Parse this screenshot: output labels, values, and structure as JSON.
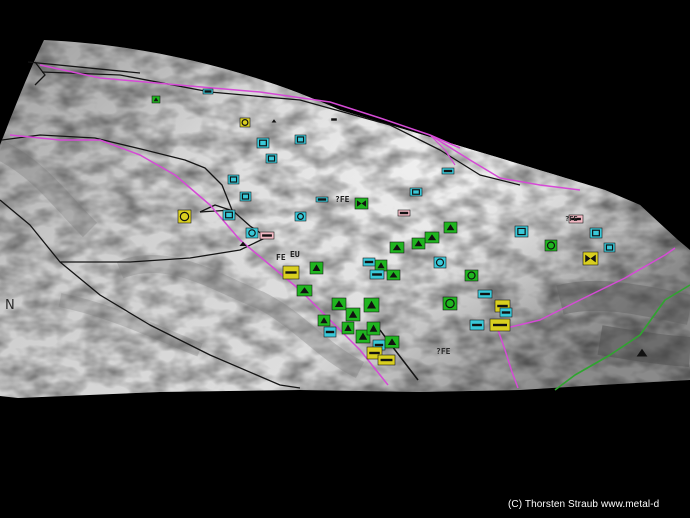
{
  "credit_text": "(C)   Thorsten Straub www.metal-d",
  "map_letter": "N",
  "symbol_texts": [
    "?FE",
    "?FE",
    "FE",
    "EU",
    "?FE"
  ],
  "colors": {
    "background": "#000000",
    "route_magenta": "#d64ad6",
    "route_black": "#141414",
    "boundary_green": "#2fa52f",
    "unit_green": "#1fb51f",
    "unit_cyan": "#39c9d9",
    "unit_yellow": "#d9cf1f",
    "unit_pink": "#f2b9c4"
  },
  "map_symbols": {
    "green_unit_icons": 23,
    "cyan_unit_icons": 24,
    "yellow_unit_icons": 9,
    "pink_unit_icons": 3,
    "white_unit_icons": 3
  }
}
